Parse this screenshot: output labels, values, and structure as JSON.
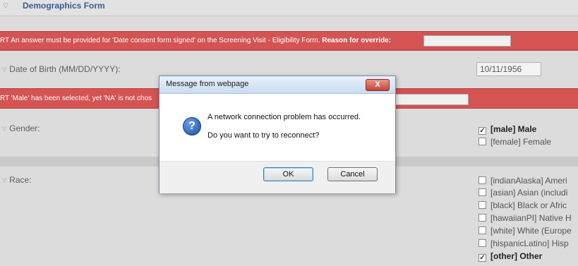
{
  "header": {
    "title": "Demographics Form"
  },
  "alerts": [
    {
      "text": "RT An answer must be provided for 'Date consent form signed' on the Screening Visit - Eligibility Form.",
      "bold": "Reason for override:"
    },
    {
      "text": "RT 'Male' has been selected, yet 'NA' is not chos"
    }
  ],
  "fields": {
    "dob": {
      "label": "Date of Birth (MM/DD/YYYY):",
      "value": "10/11/1956"
    },
    "gender": {
      "label": "Gender:",
      "options": [
        {
          "label": "[male] Male",
          "checked": true
        },
        {
          "label": "[female] Female",
          "checked": false
        }
      ]
    },
    "race": {
      "label": "Race:",
      "options": [
        {
          "label": "[indianAlaska] Ameri",
          "checked": false
        },
        {
          "label": "[asian] Asian (includi",
          "checked": false
        },
        {
          "label": "[black] Black or Afric",
          "checked": false
        },
        {
          "label": "[hawaiianPI] Native H",
          "checked": false
        },
        {
          "label": "[white] White (Europe",
          "checked": false
        },
        {
          "label": "[hispanicLatino] Hisp",
          "checked": false
        },
        {
          "label": "[other] Other",
          "checked": true
        }
      ]
    }
  },
  "dialog": {
    "title": "Message from webpage",
    "close_label": "X",
    "line1": "A network connection problem has occurred.",
    "line2": "Do you want to try to reconnect?",
    "ok_label": "OK",
    "cancel_label": "Cancel",
    "icon": "question-icon"
  }
}
